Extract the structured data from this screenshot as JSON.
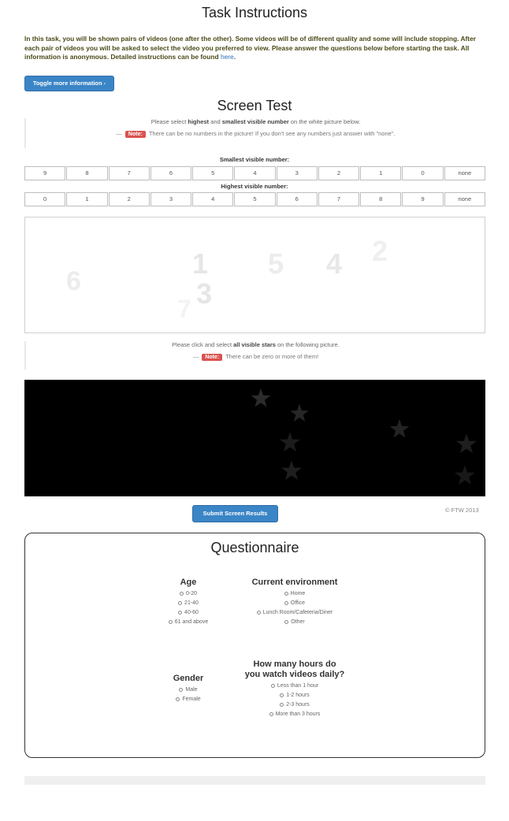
{
  "header": {
    "title": "Task Instructions",
    "intro": "In this task, you will be shown pairs of videos (one after the other). Some videos will be of different quality and some will include stopping. After each pair of videos you will be asked to select the video you preferred to view. Please answer the questions below before starting the task. All information is anonymous. Detailed instructions can be found",
    "intro_link": "here",
    "intro_end": ".",
    "toggle_button": "Toggle more information -"
  },
  "screen_test": {
    "title": "Screen Test",
    "numbers_instruction": {
      "pre": "Please select",
      "bold1": "highest",
      "mid1": "and",
      "bold2": "smallest",
      "bold3": "visible number",
      "post": "on the white picture below."
    },
    "numbers_note": {
      "badge": "Note:",
      "text": "There can be no numbers in the picture! If you don't see any numbers just answer with \"none\"."
    },
    "smallest_label": "Smallest visible number:",
    "smallest_options": [
      "9",
      "8",
      "7",
      "6",
      "5",
      "4",
      "3",
      "2",
      "1",
      "0",
      "none"
    ],
    "highest_label": "Highest visible number:",
    "highest_options": [
      "0",
      "1",
      "2",
      "3",
      "4",
      "5",
      "6",
      "7",
      "8",
      "9",
      "none"
    ],
    "white_picture_numbers": [
      "6",
      "1",
      "3",
      "7",
      "5",
      "4",
      "2"
    ],
    "stars_instruction": {
      "pre": "Please click and select",
      "bold": "all visible stars",
      "post": "on the following picture."
    },
    "stars_note": {
      "badge": "Note:",
      "text": "There can be zero or more of them!"
    },
    "submit_button": "Submit Screen Results",
    "copyright": "© FTW 2013"
  },
  "questionnaire": {
    "title": "Questionnaire",
    "age": {
      "label": "Age",
      "options": [
        "0-20",
        "21-40",
        "40-60",
        "61 and above"
      ]
    },
    "environment": {
      "label": "Current environment",
      "options": [
        "Home",
        "Office",
        "Lunch Room/Cafeteria/Diner",
        "Other"
      ]
    },
    "gender": {
      "label": "Gender",
      "options": [
        "Male",
        "Female"
      ]
    },
    "hours": {
      "label_line1": "How many hours do",
      "label_line2": "you watch videos daily?",
      "options": [
        "Less than 1 hour",
        "1-2 hours",
        "2-3 hours",
        "More than 3 hours"
      ]
    }
  },
  "colors": {
    "primary_button": "#3a85c6",
    "note_badge": "#d9534f",
    "star_fill": "#262626"
  }
}
